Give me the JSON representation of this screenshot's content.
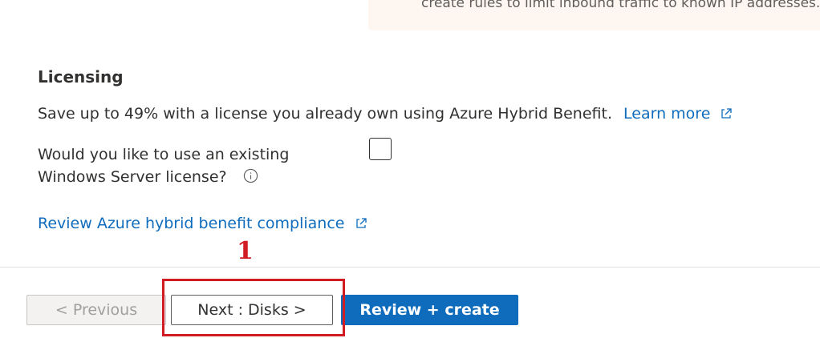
{
  "info_box": {
    "text": "create rules to limit inbound traffic to known IP addresses."
  },
  "licensing": {
    "title": "Licensing",
    "description": "Save up to 49% with a license you already own using Azure Hybrid Benefit.",
    "learn_more": "Learn more",
    "question_line1": "Would you like to use an existing",
    "question_line2": "Windows Server license?",
    "checkbox_checked": false,
    "compliance_link": "Review Azure hybrid benefit compliance"
  },
  "annotation": {
    "label": "1",
    "color": "#d01c22"
  },
  "footer": {
    "previous": "< Previous",
    "next": "Next : Disks >",
    "review": "Review + create"
  },
  "colors": {
    "link": "#0f6cbd",
    "primary": "#0f6cbd",
    "annotation": "#d01c22"
  },
  "icons": [
    "external-link-icon",
    "info-icon"
  ]
}
